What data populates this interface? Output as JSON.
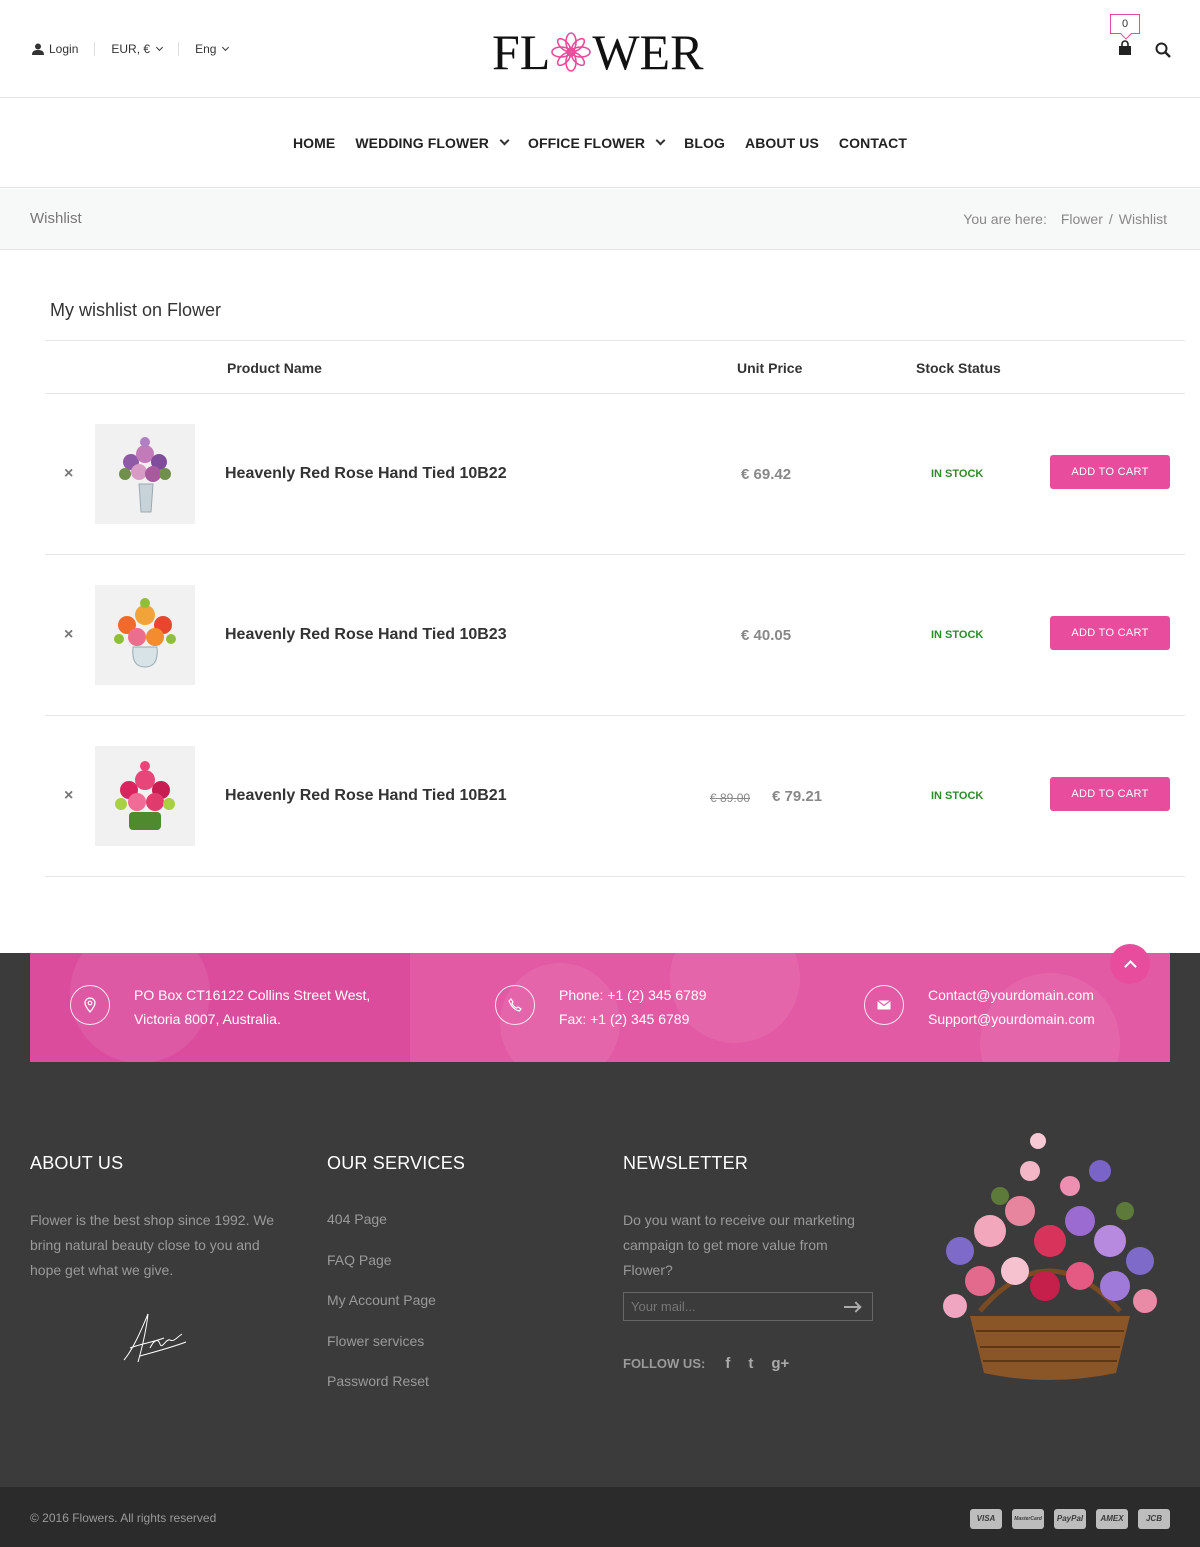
{
  "header": {
    "login": "Login",
    "currency": "EUR, €",
    "language": "Eng",
    "logo_left": "FL",
    "logo_right": "WER",
    "cart_count": "0"
  },
  "nav": {
    "items": [
      "HOME",
      "WEDDING FLOWER",
      "OFFICE FLOWER",
      "BLOG",
      "ABOUT US",
      "CONTACT"
    ]
  },
  "breadcrumb": {
    "page_title": "Wishlist",
    "prefix": "You are here:",
    "home": "Flower",
    "separator": "/",
    "current": "Wishlist"
  },
  "wishlist": {
    "title": "My wishlist on Flower",
    "columns": {
      "product": "Product Name",
      "price": "Unit Price",
      "stock": "Stock Status"
    },
    "remove_symbol": "×",
    "rows": [
      {
        "name": "Heavenly Red Rose Hand Tied 10B22",
        "old_price": "",
        "price": "€ 69.42",
        "stock": "IN STOCK",
        "button": "ADD TO CART"
      },
      {
        "name": "Heavenly Red Rose Hand Tied 10B23",
        "old_price": "",
        "price": "€ 40.05",
        "stock": "IN STOCK",
        "button": "ADD TO CART"
      },
      {
        "name": "Heavenly Red Rose Hand Tied 10B21",
        "old_price": "€ 89.00",
        "price": "€ 79.21",
        "stock": "IN STOCK",
        "button": "ADD TO CART"
      }
    ]
  },
  "contact": {
    "address_line1": "PO Box CT16122 Collins Street West,",
    "address_line2": "Victoria 8007, Australia.",
    "phone": "Phone: +1 (2) 345 6789",
    "fax": "Fax: +1 (2) 345 6789",
    "email1": "Contact@yourdomain.com",
    "email2": "Support@yourdomain.com"
  },
  "footer": {
    "about_title": "ABOUT US",
    "about_text": "Flower is the best shop since 1992. We bring natural beauty close to you and hope get what we give.",
    "services_title": "OUR SERVICES",
    "services": [
      "404 Page",
      "FAQ Page",
      "My Account Page",
      "Flower services",
      "Password Reset"
    ],
    "newsletter_title": "NEWSLETTER",
    "newsletter_text": "Do you want to receive our marketing campaign to get more value from Flower?",
    "newsletter_placeholder": "Your mail...",
    "follow_label": "FOLLOW US:",
    "social": [
      "f",
      "t",
      "g+"
    ],
    "copyright": "© 2016 Flowers. All rights reserved",
    "payments": [
      "VISA",
      "MasterCard",
      "PayPal",
      "AMEX",
      "JCB"
    ]
  },
  "colors": {
    "accent": "#e84c9c",
    "footer_bg": "#3b3b3b",
    "bottom_bg": "#2b2b2b",
    "in_stock": "#2f8a2f"
  },
  "icons": [
    "user-icon",
    "flower-logo-icon",
    "cart-icon",
    "search-icon",
    "chevron-down-icon",
    "close-icon",
    "location-icon",
    "phone-icon",
    "mail-icon",
    "arrow-up-icon",
    "arrow-right-icon",
    "facebook-icon",
    "twitter-icon",
    "google-plus-icon"
  ]
}
